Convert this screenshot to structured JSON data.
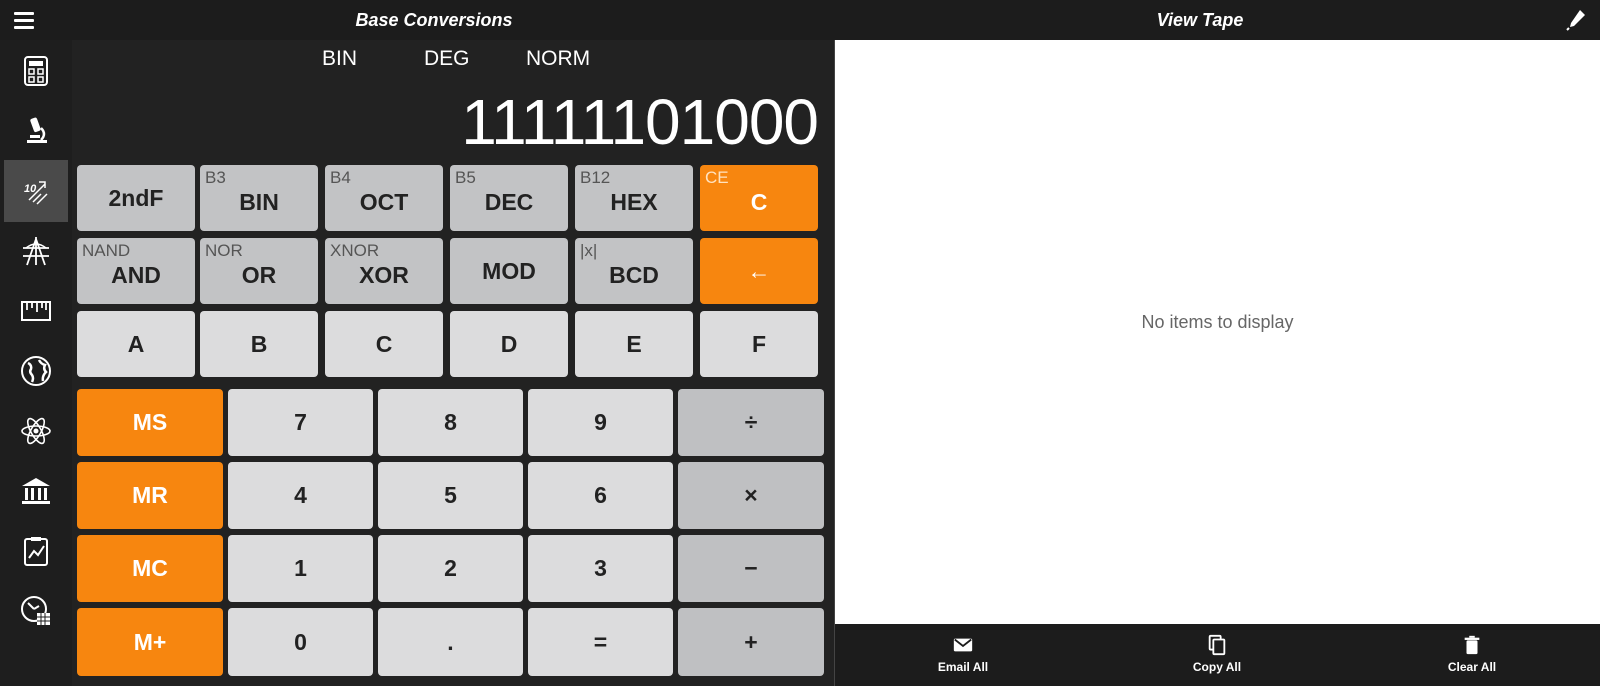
{
  "header": {
    "left_title": "Base Conversions",
    "right_title": "View Tape"
  },
  "sidebar": {
    "items": [
      {
        "icon": "calculator-icon"
      },
      {
        "icon": "microscope-icon"
      },
      {
        "icon": "base-conversion-icon",
        "active": true
      },
      {
        "icon": "geometry-icon"
      },
      {
        "icon": "ruler-icon"
      },
      {
        "icon": "globe-icon"
      },
      {
        "icon": "atom-icon"
      },
      {
        "icon": "bank-icon"
      },
      {
        "icon": "chart-clipboard-icon"
      },
      {
        "icon": "time-calendar-icon"
      }
    ]
  },
  "calculator": {
    "modes": [
      "BIN",
      "DEG",
      "NORM"
    ],
    "display": "11111101000",
    "rows": [
      [
        {
          "main": "2ndF",
          "sub": ""
        },
        {
          "main": "BIN",
          "sub": "B3"
        },
        {
          "main": "OCT",
          "sub": "B4"
        },
        {
          "main": "DEC",
          "sub": "B5"
        },
        {
          "main": "HEX",
          "sub": "B12"
        },
        {
          "main": "C",
          "sub": "CE"
        }
      ],
      [
        {
          "main": "AND",
          "sub": "NAND"
        },
        {
          "main": "OR",
          "sub": "NOR"
        },
        {
          "main": "XOR",
          "sub": "XNOR"
        },
        {
          "main": "MOD",
          "sub": ""
        },
        {
          "main": "BCD",
          "sub": "|x|"
        },
        {
          "main": "←",
          "sub": ""
        }
      ],
      [
        {
          "main": "A"
        },
        {
          "main": "B"
        },
        {
          "main": "C"
        },
        {
          "main": "D"
        },
        {
          "main": "E"
        },
        {
          "main": "F"
        }
      ]
    ],
    "grid": [
      [
        "MS",
        "7",
        "8",
        "9",
        "÷"
      ],
      [
        "MR",
        "4",
        "5",
        "6",
        "×"
      ],
      [
        "MC",
        "1",
        "2",
        "3",
        "−"
      ],
      [
        "M+",
        "0",
        ".",
        "=",
        "+"
      ]
    ]
  },
  "tape": {
    "empty_text": "No items to display",
    "actions": [
      {
        "label": "Email All",
        "icon": "mail-icon"
      },
      {
        "label": "Copy All",
        "icon": "copy-icon"
      },
      {
        "label": "Clear All",
        "icon": "trash-icon"
      }
    ]
  },
  "colors": {
    "accent": "#f7860f",
    "key_gray": "#c2c3c5",
    "key_light": "#dcdcdd",
    "background": "#222222"
  }
}
